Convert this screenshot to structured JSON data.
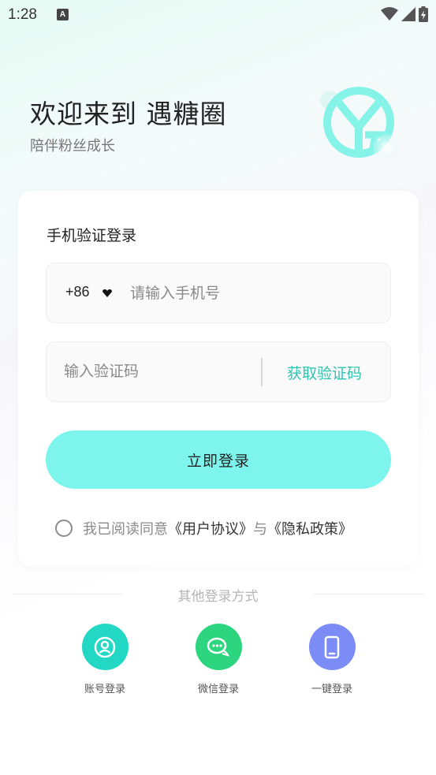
{
  "status_bar": {
    "time": "1:28",
    "notification_letter": "A",
    "icons": [
      "wifi-icon",
      "signal-icon",
      "battery-icon"
    ]
  },
  "header": {
    "title": "欢迎来到 遇糖圈",
    "subtitle": "陪伴粉丝成长"
  },
  "login_card": {
    "title": "手机验证登录",
    "country_code": "+86",
    "phone_placeholder": "请输入手机号",
    "code_placeholder": "输入验证码",
    "get_code_label": "获取验证码",
    "login_button_label": "立即登录",
    "agreement": {
      "prefix": "我已阅读同意",
      "user_agreement": "《用户协议》",
      "conjunction": "与",
      "privacy_policy": "《隐私政策》",
      "checked": false
    }
  },
  "other_login": {
    "title": "其他登录方式",
    "methods": [
      {
        "label": "账号登录",
        "icon": "account-icon",
        "color": "#22d8c4"
      },
      {
        "label": "微信登录",
        "icon": "wechat-icon",
        "color": "#2dd67e"
      },
      {
        "label": "一键登录",
        "icon": "phone-icon",
        "color": "#7b8cf7"
      }
    ]
  },
  "colors": {
    "accent": "#7ef5ec",
    "link": "#2cc6b0"
  }
}
